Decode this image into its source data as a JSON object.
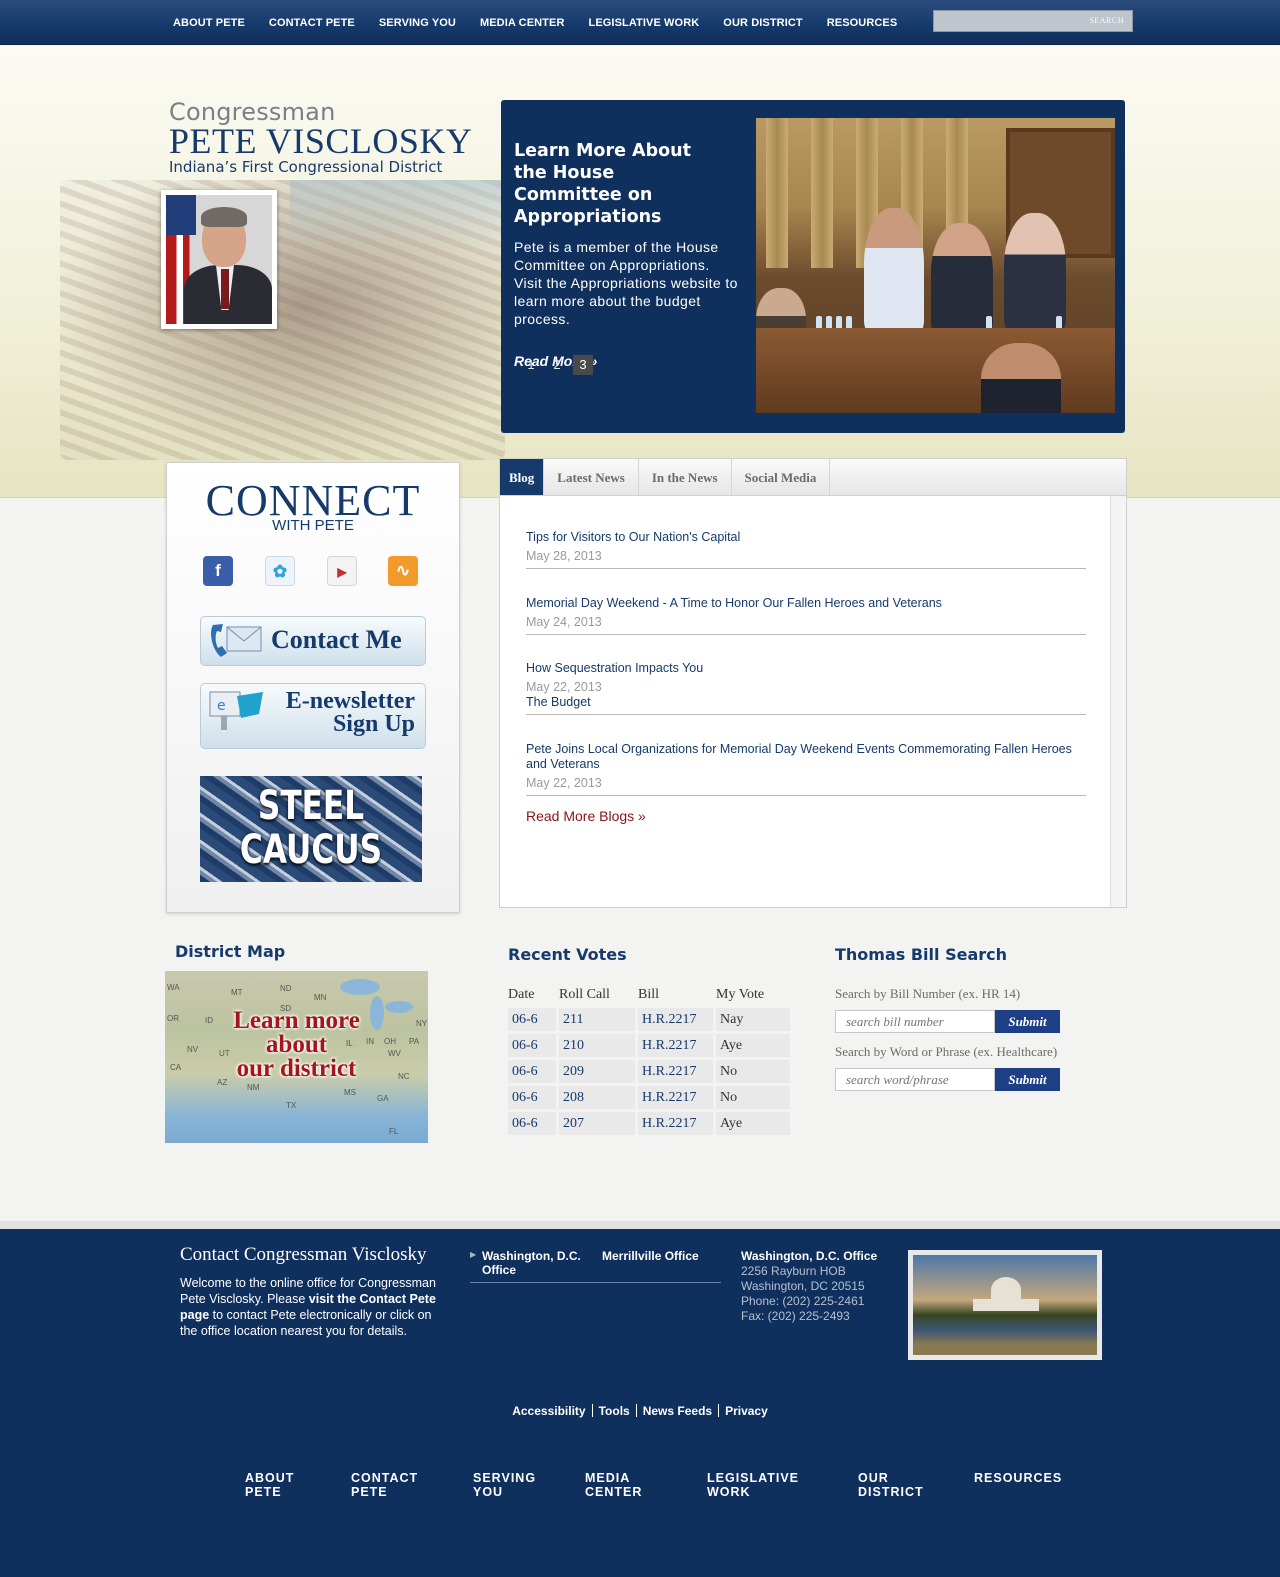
{
  "nav": {
    "items": [
      "ABOUT PETE",
      "CONTACT PETE",
      "SERVING YOU",
      "MEDIA CENTER",
      "LEGISLATIVE WORK",
      "OUR DISTRICT",
      "RESOURCES"
    ],
    "search_label": "SEARCH"
  },
  "header": {
    "congressman": "Congressman",
    "name": "PETE VISCLOSKY",
    "district": "Indiana’s First Congressional District"
  },
  "feature": {
    "title": "Learn More About the House Committee on Appropriations",
    "text": "Pete is a member of the House Committee on Appropriations. Visit the Appropriations website to learn more about the budget process.",
    "read_more": "Read More »",
    "slides": [
      "1",
      "2",
      "3"
    ],
    "active_slide": "3"
  },
  "connect": {
    "title": "CONNECT",
    "subtitle": "WITH PETE",
    "social": [
      "facebook-icon",
      "twitter-icon",
      "youtube-icon",
      "rss-icon"
    ],
    "contact_label": "Contact Me",
    "newsletter_line1": "E-newsletter",
    "newsletter_line2": "Sign Up",
    "steel_line1": "STEEL",
    "steel_line2": "CAUCUS"
  },
  "tabs": {
    "labels": [
      "Blog",
      "Latest News",
      "In the News",
      "Social Media"
    ],
    "active": "Blog",
    "posts": [
      {
        "title": "Tips for Visitors to Our Nation's Capital",
        "date": "May 28, 2013",
        "tag": ""
      },
      {
        "title": "Memorial Day Weekend - A Time to Honor Our Fallen Heroes and Veterans",
        "date": "May 24, 2013",
        "tag": ""
      },
      {
        "title": "How Sequestration Impacts You",
        "date": "May 22, 2013",
        "tag": "The Budget"
      },
      {
        "title": "Pete Joins Local Organizations for Memorial Day Weekend Events Commemorating Fallen Heroes and Veterans",
        "date": "May 22, 2013",
        "tag": ""
      }
    ],
    "read_more": "Read More Blogs »"
  },
  "district_map": {
    "title": "District Map",
    "label_line1": "Learn more",
    "label_line2": "about",
    "label_line3": "our district",
    "states": [
      "WA",
      "MT",
      "ND",
      "MN",
      "SD",
      "OR",
      "ID",
      "NV",
      "UT",
      "CA",
      "AZ",
      "NM",
      "TX",
      "IL",
      "IN",
      "OH",
      "PA",
      "NY",
      "WV",
      "NC",
      "MS",
      "GA",
      "FL"
    ]
  },
  "votes": {
    "title": "Recent Votes",
    "headers": [
      "Date",
      "Roll Call",
      "Bill",
      "My Vote"
    ],
    "rows": [
      [
        "06-6",
        "211",
        "H.R.2217",
        "Nay"
      ],
      [
        "06-6",
        "210",
        "H.R.2217",
        "Aye"
      ],
      [
        "06-6",
        "209",
        "H.R.2217",
        "No"
      ],
      [
        "06-6",
        "208",
        "H.R.2217",
        "No"
      ],
      [
        "06-6",
        "207",
        "H.R.2217",
        "Aye"
      ]
    ]
  },
  "thomas": {
    "title": "Thomas Bill Search",
    "bill_label": "Search by Bill Number (ex. HR 14)",
    "bill_placeholder": "search bill number",
    "word_label": "Search by Word or Phrase (ex. Healthcare)",
    "word_placeholder": "search word/phrase",
    "submit": "Submit"
  },
  "footer": {
    "title": "Contact Congressman Visclosky",
    "welcome_1": "Welcome to the online office for Congressman Pete Visclosky. Please ",
    "welcome_bold": "visit the Contact Pete page",
    "welcome_2": " to contact Pete electronically or click on the office location nearest you for details.",
    "office_tabs": [
      "Washington, D.C. Office",
      "Merrillville Office"
    ],
    "address": {
      "heading": "Washington, D.C. Office",
      "line1": "2256 Rayburn HOB",
      "line2": "Washington, DC 20515",
      "phone": "Phone: (202) 225-2461",
      "fax": "Fax: (202) 225-2493"
    },
    "links": [
      "Accessibility",
      "Tools",
      "News Feeds",
      "Privacy"
    ],
    "nav": [
      [
        "ABOUT",
        "PETE"
      ],
      [
        "CONTACT",
        "PETE"
      ],
      [
        "SERVING",
        "YOU"
      ],
      [
        "MEDIA",
        "CENTER"
      ],
      [
        "LEGISLATIVE",
        "WORK"
      ],
      [
        "OUR",
        "DISTRICT"
      ],
      [
        "RESOURCES",
        ""
      ]
    ]
  },
  "colors": {
    "navy": "#0f2f5c",
    "brand_blue": "#163a6b",
    "link_red": "#8a1414",
    "submit_blue": "#1d3f86"
  }
}
